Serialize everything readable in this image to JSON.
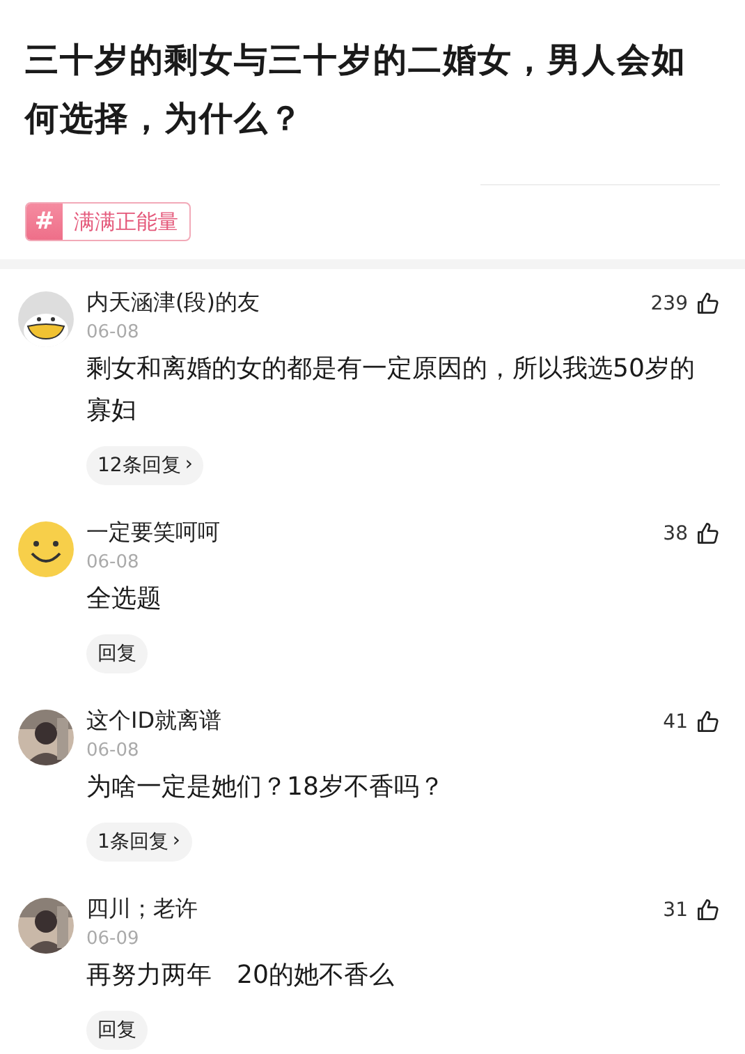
{
  "title": "三十岁的剩女与三十岁的二婚女，男人会如何选择，为什么？",
  "tag": {
    "icon": "#",
    "label": "满满正能量"
  },
  "comments": [
    {
      "kind": "cartoon",
      "name": "内天涵津(段)的友",
      "date": "06-08",
      "likes": "239",
      "text": "剩女和离婚的女的都是有一定原因的，所以我选50岁的寡妇",
      "reply": "12条回复",
      "reply_arrow": "›"
    },
    {
      "kind": "smiley",
      "name": "一定要笑呵呵",
      "date": "06-08",
      "likes": "38",
      "text": "全选题",
      "reply": "回复"
    },
    {
      "kind": "picture",
      "name": "这个ID就离谱",
      "date": "06-08",
      "likes": "41",
      "text": "为啥一定是她们？18岁不香吗？",
      "reply": "1条回复",
      "reply_arrow": "›"
    },
    {
      "kind": "picture",
      "name": "四川；老许",
      "date": "06-09",
      "likes": "31",
      "text": "再努力两年　20的她不香么",
      "reply": "回复"
    }
  ]
}
